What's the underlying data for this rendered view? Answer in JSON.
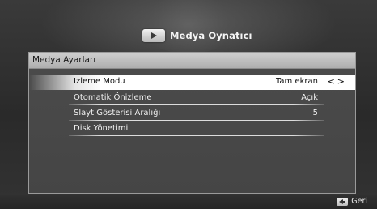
{
  "header": {
    "title": "Medya Oynatıcı",
    "icon": "media-player-icon"
  },
  "panel": {
    "title": "Medya Ayarları"
  },
  "menu": {
    "items": [
      {
        "label": "Izleme Modu",
        "value": "Tam ekran",
        "selected": true
      },
      {
        "label": "Otomatik Önizleme",
        "value": "Açık",
        "selected": false
      },
      {
        "label": "Slayt Gösterisi Aralığı",
        "value": "5",
        "selected": false
      },
      {
        "label": "Disk Yönetimi",
        "value": "",
        "selected": false
      }
    ],
    "selector_arrows": "<>"
  },
  "footer": {
    "back_label": "Geri",
    "back_icon": "back-arrow-key-icon"
  },
  "colors": {
    "selection_bg": "#ffffff",
    "panel_bg": "#4b4b4b",
    "title_bar": "#bdbdbd",
    "text_light": "#f0f0f0",
    "text_dark": "#111111"
  }
}
